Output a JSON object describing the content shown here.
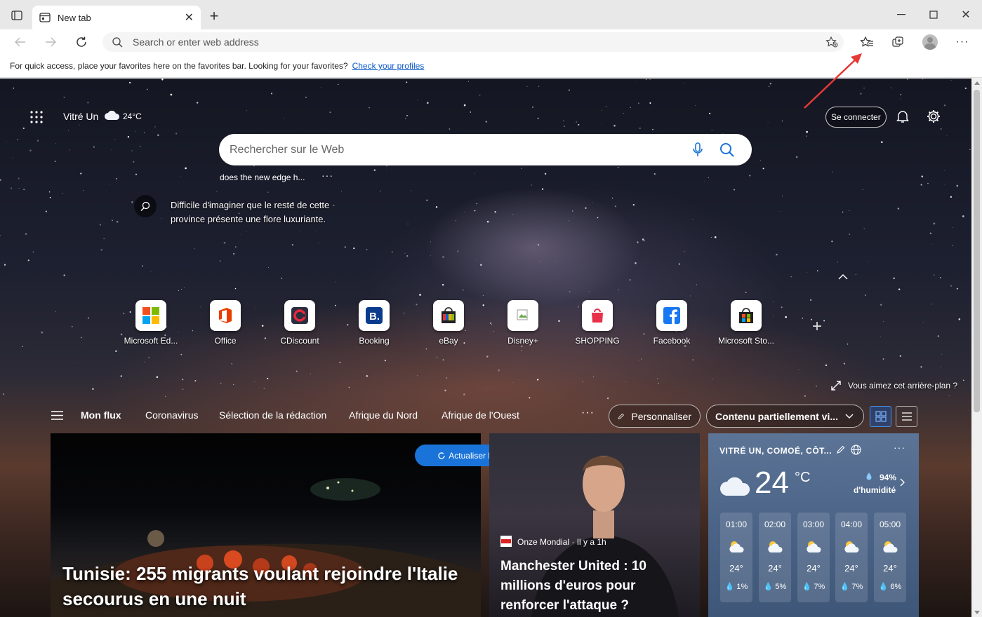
{
  "browser": {
    "tab_title": "New tab",
    "address_placeholder": "Search or enter web address",
    "favbar_message": "For quick access, place your favorites here on the favorites bar. Looking for your favorites?",
    "favbar_link": "Check your profiles"
  },
  "page": {
    "location": "Vitré Un",
    "temp": "24°C",
    "signin": "Se connecter",
    "search_placeholder": "Rechercher sur le Web",
    "suggestion": "does the new edge h...",
    "fact": "Difficile d'imaginer que le reste de cette province présente une flore luxuriante.",
    "bg_like": "Vous aimez cet arrière-plan ?"
  },
  "tiles": [
    {
      "label": "Microsoft Ed..."
    },
    {
      "label": "Office"
    },
    {
      "label": "CDiscount"
    },
    {
      "label": "Booking"
    },
    {
      "label": "eBay"
    },
    {
      "label": "Disney+"
    },
    {
      "label": "SHOPPING"
    },
    {
      "label": "Facebook"
    },
    {
      "label": "Microsoft Sto..."
    }
  ],
  "feed": {
    "nav": [
      "Mon flux",
      "Coronavirus",
      "Sélection de la rédaction",
      "Afrique du Nord",
      "Afrique de l'Ouest"
    ],
    "personalize": "Personnaliser",
    "content_mode": "Contenu partiellement vi...",
    "refresh": "Actualiser les histoires",
    "main_headline": "Tunisie: 255 migrants voulant rejoindre l'Italie secourus en une nuit",
    "side_source": "Onze Mondial · Il y a 1h",
    "side_headline": "Manchester United : 10 millions d'euros pour renforcer l'attaque ?"
  },
  "weather": {
    "location": "VITRÉ UN, COMOÉ, CÔT...",
    "temp": "24",
    "unit": "°C",
    "humidity_value": "94%",
    "humidity_label": "d'humidité",
    "hours": [
      {
        "time": "01:00",
        "temp": "24°",
        "precip": "1%"
      },
      {
        "time": "02:00",
        "temp": "24°",
        "precip": "5%"
      },
      {
        "time": "03:00",
        "temp": "24°",
        "precip": "7%"
      },
      {
        "time": "04:00",
        "temp": "24°",
        "precip": "7%"
      },
      {
        "time": "05:00",
        "temp": "24°",
        "precip": "6%"
      }
    ]
  }
}
